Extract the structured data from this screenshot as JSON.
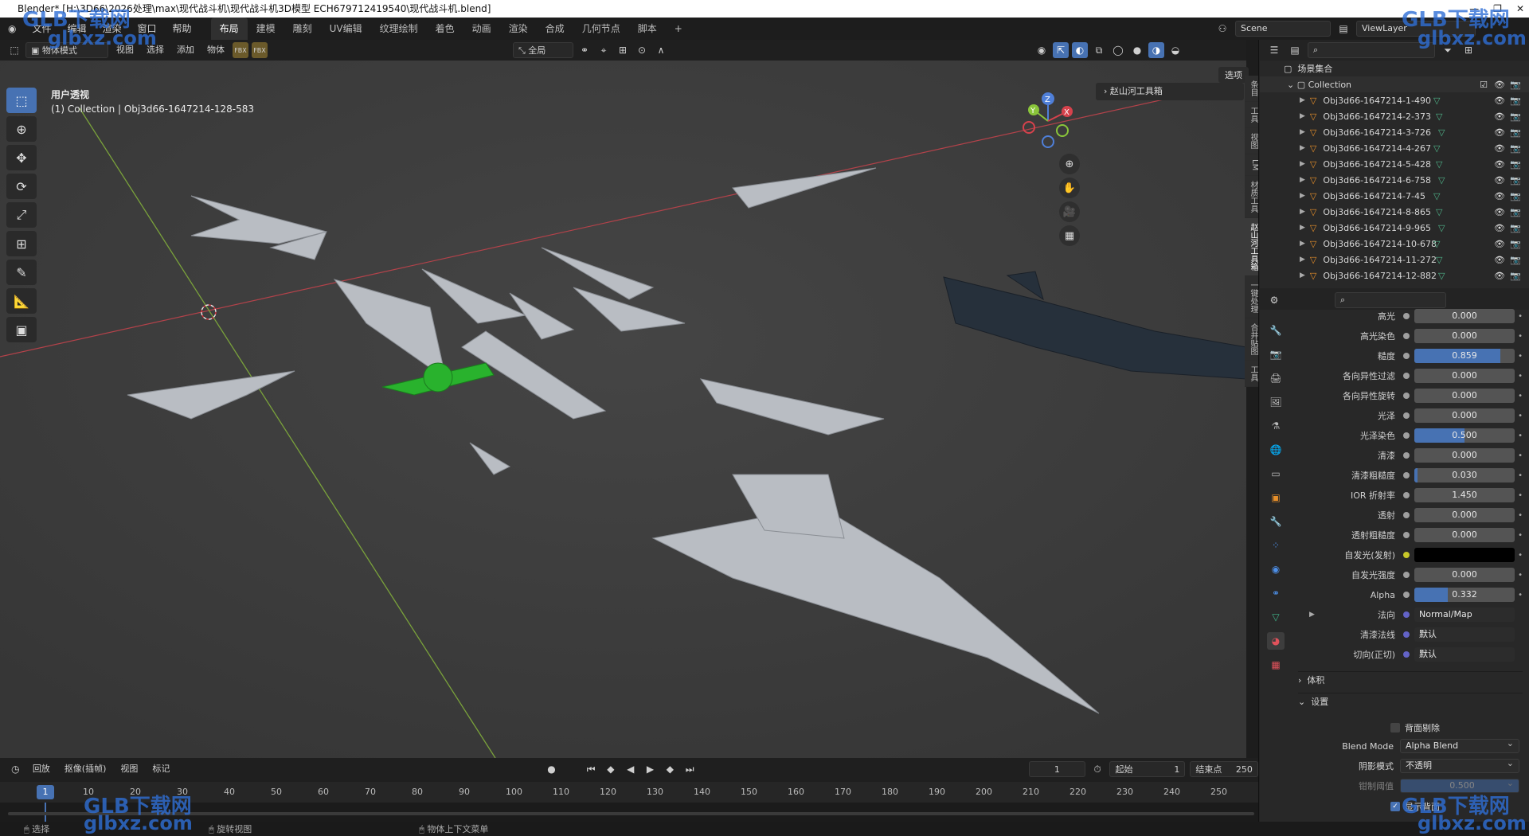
{
  "window": {
    "title": "Blender* [H:\\3D66\\2026处理\\max\\现代战斗机\\现代战斗机3D模型 ECH679712419540\\现代战斗机.blend]",
    "controls": [
      "—",
      "❐",
      "✕"
    ]
  },
  "menu": [
    "文件",
    "编辑",
    "渲染",
    "窗口",
    "帮助"
  ],
  "workspaces": [
    "布局",
    "建模",
    "雕刻",
    "UV编辑",
    "纹理绘制",
    "着色",
    "动画",
    "渲染",
    "合成",
    "几何节点",
    "脚本"
  ],
  "active_workspace": "布局",
  "scene": {
    "scene_name": "Scene",
    "view_layer": "ViewLayer"
  },
  "viewport_header": {
    "mode": "物体模式",
    "menus": [
      "视图",
      "选择",
      "添加",
      "物体"
    ],
    "transform_orientation": "全局",
    "options_label": "选项"
  },
  "viewport": {
    "view_name": "用户透视",
    "collection_info": "(1) Collection | Obj3d66-1647214-128-583",
    "npanel_title": "赵山河工具箱"
  },
  "ntabs": [
    "条目",
    "工具",
    "视图",
    "LM",
    "材质工具",
    "赵山河工具箱",
    "一键处理",
    "合并贴图",
    "工具"
  ],
  "gizmo": {
    "z": "Z",
    "y": "Y",
    "x": "X"
  },
  "outliner": {
    "scene_collection": "场景集合",
    "collection": "Collection",
    "objects": [
      "Obj3d66-1647214-1-490",
      "Obj3d66-1647214-2-373",
      "Obj3d66-1647214-3-726",
      "Obj3d66-1647214-4-267",
      "Obj3d66-1647214-5-428",
      "Obj3d66-1647214-6-758",
      "Obj3d66-1647214-7-45",
      "Obj3d66-1647214-8-865",
      "Obj3d66-1647214-9-965",
      "Obj3d66-1647214-10-678",
      "Obj3d66-1647214-11-272",
      "Obj3d66-1647214-12-882"
    ]
  },
  "properties": {
    "rows": [
      {
        "label": "高光",
        "value": "0.000",
        "fill": 0
      },
      {
        "label": "高光染色",
        "value": "0.000",
        "fill": 0
      },
      {
        "label": "糙度",
        "value": "0.859",
        "fill": 0.859
      },
      {
        "label": "各向异性过滤",
        "value": "0.000",
        "fill": 0
      },
      {
        "label": "各向异性旋转",
        "value": "0.000",
        "fill": 0
      },
      {
        "label": "光泽",
        "value": "0.000",
        "fill": 0
      },
      {
        "label": "光泽染色",
        "value": "0.500",
        "fill": 0.5
      },
      {
        "label": "清漆",
        "value": "0.000",
        "fill": 0
      },
      {
        "label": "清漆粗糙度",
        "value": "0.030",
        "fill": 0.03
      },
      {
        "label": "IOR 折射率",
        "value": "1.450",
        "fill": 0
      },
      {
        "label": "透射",
        "value": "0.000",
        "fill": 0
      },
      {
        "label": "透射粗糙度",
        "value": "0.000",
        "fill": 0
      },
      {
        "label": "自发光(发射)",
        "value": "",
        "fill": 0
      },
      {
        "label": "自发光强度",
        "value": "0.000",
        "fill": 0
      },
      {
        "label": "Alpha",
        "value": "0.332",
        "fill": 0.332
      },
      {
        "label": "法向",
        "value": "Normal/Map",
        "fill": 0
      },
      {
        "label": "清漆法线",
        "value": "默认",
        "fill": 0
      },
      {
        "label": "切向(正切)",
        "value": "默认",
        "fill": 0
      }
    ],
    "section_volume": "体积",
    "section_settings": "设置",
    "backface_culling": "背面剔除",
    "blend_mode_label": "Blend Mode",
    "blend_mode_value": "Alpha Blend",
    "shadow_mode_label": "阴影模式",
    "shadow_mode_value": "不透明",
    "clip_threshold_label": "钳制阈值",
    "clip_threshold_value": "0.500",
    "show_backface": "显示背面"
  },
  "timeline": {
    "menus": [
      "回放",
      "抠像(插帧)",
      "视图",
      "标记"
    ],
    "current_frame": "1",
    "start_label": "起始",
    "start_value": "1",
    "end_label": "结束点",
    "end_value": "250",
    "ticks": [
      "10",
      "20",
      "30",
      "40",
      "50",
      "60",
      "70",
      "80",
      "90",
      "100",
      "110",
      "120",
      "130",
      "140",
      "150",
      "160",
      "170",
      "180",
      "190",
      "200",
      "210",
      "220",
      "230",
      "240",
      "250"
    ],
    "playhead": "1"
  },
  "status": {
    "left": "选择",
    "middle": "旋转视图",
    "right": "物体上下文菜单"
  },
  "watermark": {
    "brand": "GLB下载网",
    "url": "glbxz.com"
  }
}
